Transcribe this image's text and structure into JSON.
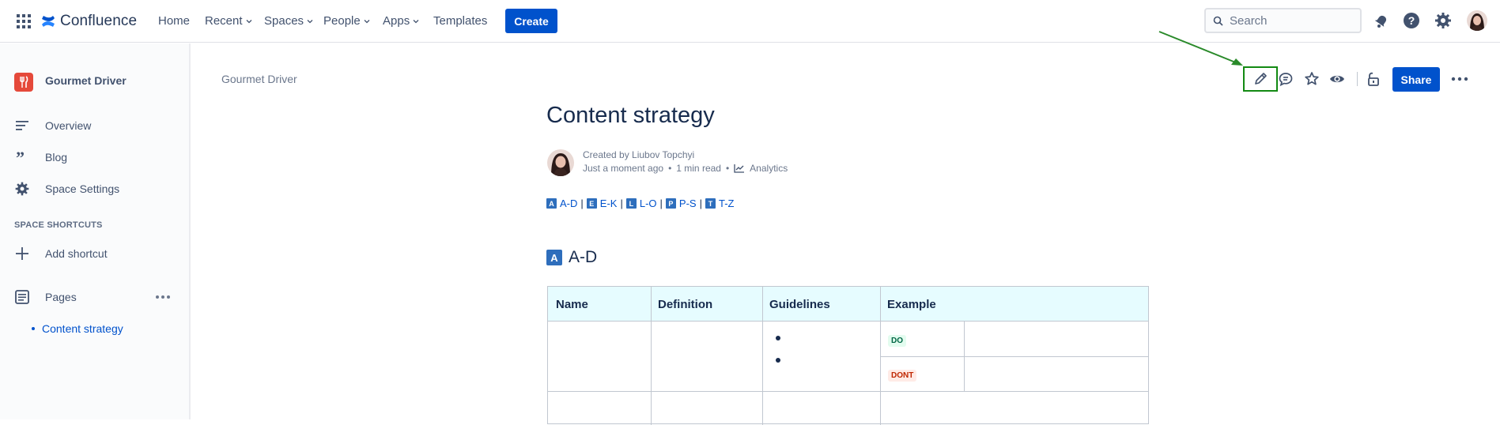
{
  "header": {
    "app_name": "Confluence",
    "nav": [
      {
        "label": "Home",
        "has_dropdown": false
      },
      {
        "label": "Recent",
        "has_dropdown": true
      },
      {
        "label": "Spaces",
        "has_dropdown": true
      },
      {
        "label": "People",
        "has_dropdown": true
      },
      {
        "label": "Apps",
        "has_dropdown": true
      },
      {
        "label": "Templates",
        "has_dropdown": false
      }
    ],
    "create_label": "Create",
    "search_placeholder": "Search",
    "icons": [
      "app-switcher-icon",
      "confluence-logo-icon",
      "search-icon",
      "notifications-icon",
      "help-icon",
      "settings-icon",
      "user-avatar"
    ]
  },
  "sidebar": {
    "space_name": "Gourmet Driver",
    "items": [
      {
        "label": "Overview",
        "icon": "overview-icon"
      },
      {
        "label": "Blog",
        "icon": "quote-icon"
      },
      {
        "label": "Space Settings",
        "icon": "gear-icon"
      }
    ],
    "shortcuts_heading": "SPACE SHORTCUTS",
    "add_shortcut_label": "Add shortcut",
    "pages_label": "Pages",
    "page_tree": [
      {
        "label": "Content strategy"
      }
    ]
  },
  "content": {
    "breadcrumb": "Gourmet Driver",
    "toolbar_icons": [
      "edit-icon",
      "comment-icon",
      "star-icon",
      "watch-icon",
      "restrictions-icon",
      "more-icon"
    ],
    "share_label": "Share",
    "title": "Content strategy",
    "byline": {
      "created_by": "Created by Liubov Topchyi",
      "time": "Just a moment ago",
      "read_time": "1 min read",
      "analytics": "Analytics"
    },
    "letter_nav": [
      {
        "badge": "A",
        "label": "A-D"
      },
      {
        "badge": "E",
        "label": "E-K"
      },
      {
        "badge": "L",
        "label": "L-O"
      },
      {
        "badge": "P",
        "label": "P-S"
      },
      {
        "badge": "T",
        "label": "T-Z"
      }
    ],
    "section": {
      "badge": "A",
      "title": "A-D"
    },
    "table": {
      "headers": [
        "Name",
        "Definition",
        "Guidelines",
        "Example"
      ],
      "lozenges": {
        "do": "DO",
        "dont": "DONT"
      }
    }
  },
  "colors": {
    "primary": "#0052cc",
    "highlight_box": "#138a13",
    "table_header_bg": "#e6fcff",
    "space_logo": "#e5493a"
  }
}
